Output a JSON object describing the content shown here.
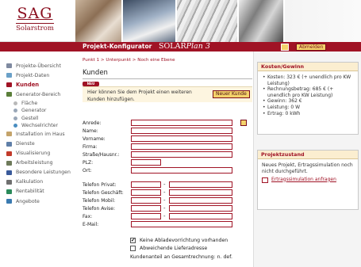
{
  "header": {
    "logo_main": "SAG",
    "logo_sub": "Solarstrom",
    "module_title": "Projekt-Konfigurator",
    "brand_prefix": "SOLAR",
    "brand_suffix": "Plan 3",
    "logout_label": "Abmelden"
  },
  "nav": {
    "items": [
      {
        "label": "Projekte-Übersicht",
        "icon": "folder-list-icon",
        "color": "#7f8aa0"
      },
      {
        "label": "Projekt-Daten",
        "icon": "document-icon",
        "color": "#6aa0c8"
      },
      {
        "label": "Kunden",
        "icon": "people-icon",
        "color": "#a01325"
      },
      {
        "label": "Generator-Bereich",
        "icon": "generator-icon",
        "color": "#5b7f3a"
      },
      {
        "label": "Fläche",
        "icon": "area-icon",
        "color": "#b9b9b9"
      },
      {
        "label": "Generator",
        "icon": "generator-small-icon",
        "color": "#9aa7b8"
      },
      {
        "label": "Gestell",
        "icon": "rack-icon",
        "color": "#9aa7b8"
      },
      {
        "label": "Wechselrichter",
        "icon": "inverter-icon",
        "color": "#4a8dc0"
      },
      {
        "label": "Installation im Haus",
        "icon": "house-icon",
        "color": "#c4a36a"
      },
      {
        "label": "Dienste",
        "icon": "services-icon",
        "color": "#5f7fa8"
      },
      {
        "label": "Visualisierung",
        "icon": "visualization-icon",
        "color": "#c23a2a"
      },
      {
        "label": "Arbeitsleistung",
        "icon": "work-icon",
        "color": "#6e7a5a"
      },
      {
        "label": "Besondere Leistungen",
        "icon": "special-services-icon",
        "color": "#3a5a9a"
      },
      {
        "label": "Kalkulation",
        "icon": "calculator-icon",
        "color": "#6f6f6f"
      },
      {
        "label": "Rentabilität",
        "icon": "profitability-icon",
        "color": "#2a8a5a"
      },
      {
        "label": "Angebote",
        "icon": "offers-icon",
        "color": "#3a7ab0"
      }
    ]
  },
  "main": {
    "breadcrumb": "Punkt 1  >  Unterpunkt  >  Noch eine Ebene",
    "title": "Kunden",
    "badge": "NEU",
    "hint": "Hier können Sie dem Projekt einen weiteren Kunden hinzufügen.",
    "new_customer_button": "Neuer Kunde",
    "fields": {
      "anrede": "Anrede:",
      "name": "Name:",
      "vorname": "Vorname:",
      "firma": "Firma:",
      "strasse": "Straße/Hausnr.:",
      "plz": "PLZ:",
      "ort": "Ort:",
      "tel_privat": "Telefon Privat:",
      "tel_geschaeft": "Telefon Geschäft:",
      "tel_mobil": "Telefon Mobil:",
      "tel_avise": "Telefon Avise:",
      "fax": "Fax:",
      "email": "E-Mail:"
    },
    "dash": "-",
    "checkbox_no_unload": "Keine Abladevorrichtung vorhanden",
    "checkbox_no_unload_checked": true,
    "checkbox_other_address": "Abweichende Lieferadresse",
    "checkbox_other_address_checked": false,
    "customer_share": "Kundenanteil an Gesamtrechnung: n. def."
  },
  "costs": {
    "title": "Kosten/Gewinn",
    "items": [
      "Kosten: 323 € (+ unendlich pro KW Leistung)",
      "Rechnungsbetrag: 685 € (+ unendlich pro KW Leistung)",
      "Gewinn: 362 €",
      "Leistung: 0 W",
      "Ertrag: 0 kWh"
    ]
  },
  "project_state": {
    "title": "Projektzustand",
    "text": "Neues Projekt, Ertragssimulation noch nicht durchgeführt.",
    "link": "Ertragssimulation anfragen"
  },
  "colors": {
    "brand_red": "#a01325",
    "accent_yellow": "#f4d36b",
    "panel_header": "#fbeed0"
  }
}
